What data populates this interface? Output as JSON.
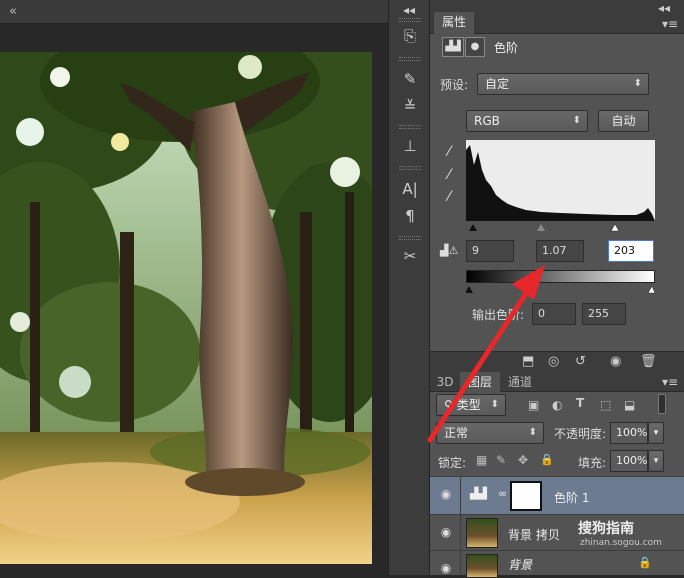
{
  "icons": {
    "doc_close": "«",
    "collapse": "◂◂",
    "panel_menu": "▾≡",
    "dropdown_arrow": "▴▾",
    "eye": "◉",
    "lock": "🔒",
    "chain": "∞"
  },
  "properties": {
    "tab_label": "属性",
    "adjustment_title": "色阶",
    "preset_label": "预设:",
    "preset_value": "自定",
    "channel_value": "RGB",
    "auto_button": "自动",
    "input_black": "9",
    "input_gamma": "1.07",
    "input_white": "203",
    "output_label": "输出色阶:",
    "output_black": "0",
    "output_white": "255"
  },
  "layers": {
    "tabs": [
      "3D",
      "图层",
      "通道"
    ],
    "filter_value": "类型",
    "blend_mode": "正常",
    "opacity_label": "不透明度:",
    "opacity_value": "100%",
    "lock_label": "锁定:",
    "fill_label": "填充:",
    "fill_value": "100%",
    "items": [
      {
        "name": "色阶 1",
        "selected": true
      },
      {
        "name": "背景 拷贝",
        "selected": false
      },
      {
        "name": "背景",
        "selected": false
      }
    ]
  },
  "watermark": {
    "text": "搜狗指南",
    "url": "zhinan.sogou.com"
  },
  "colors": {
    "panel_bg": "#535353",
    "selected_row": "#6d7b91",
    "annotation_arrow": "#e8272b"
  }
}
